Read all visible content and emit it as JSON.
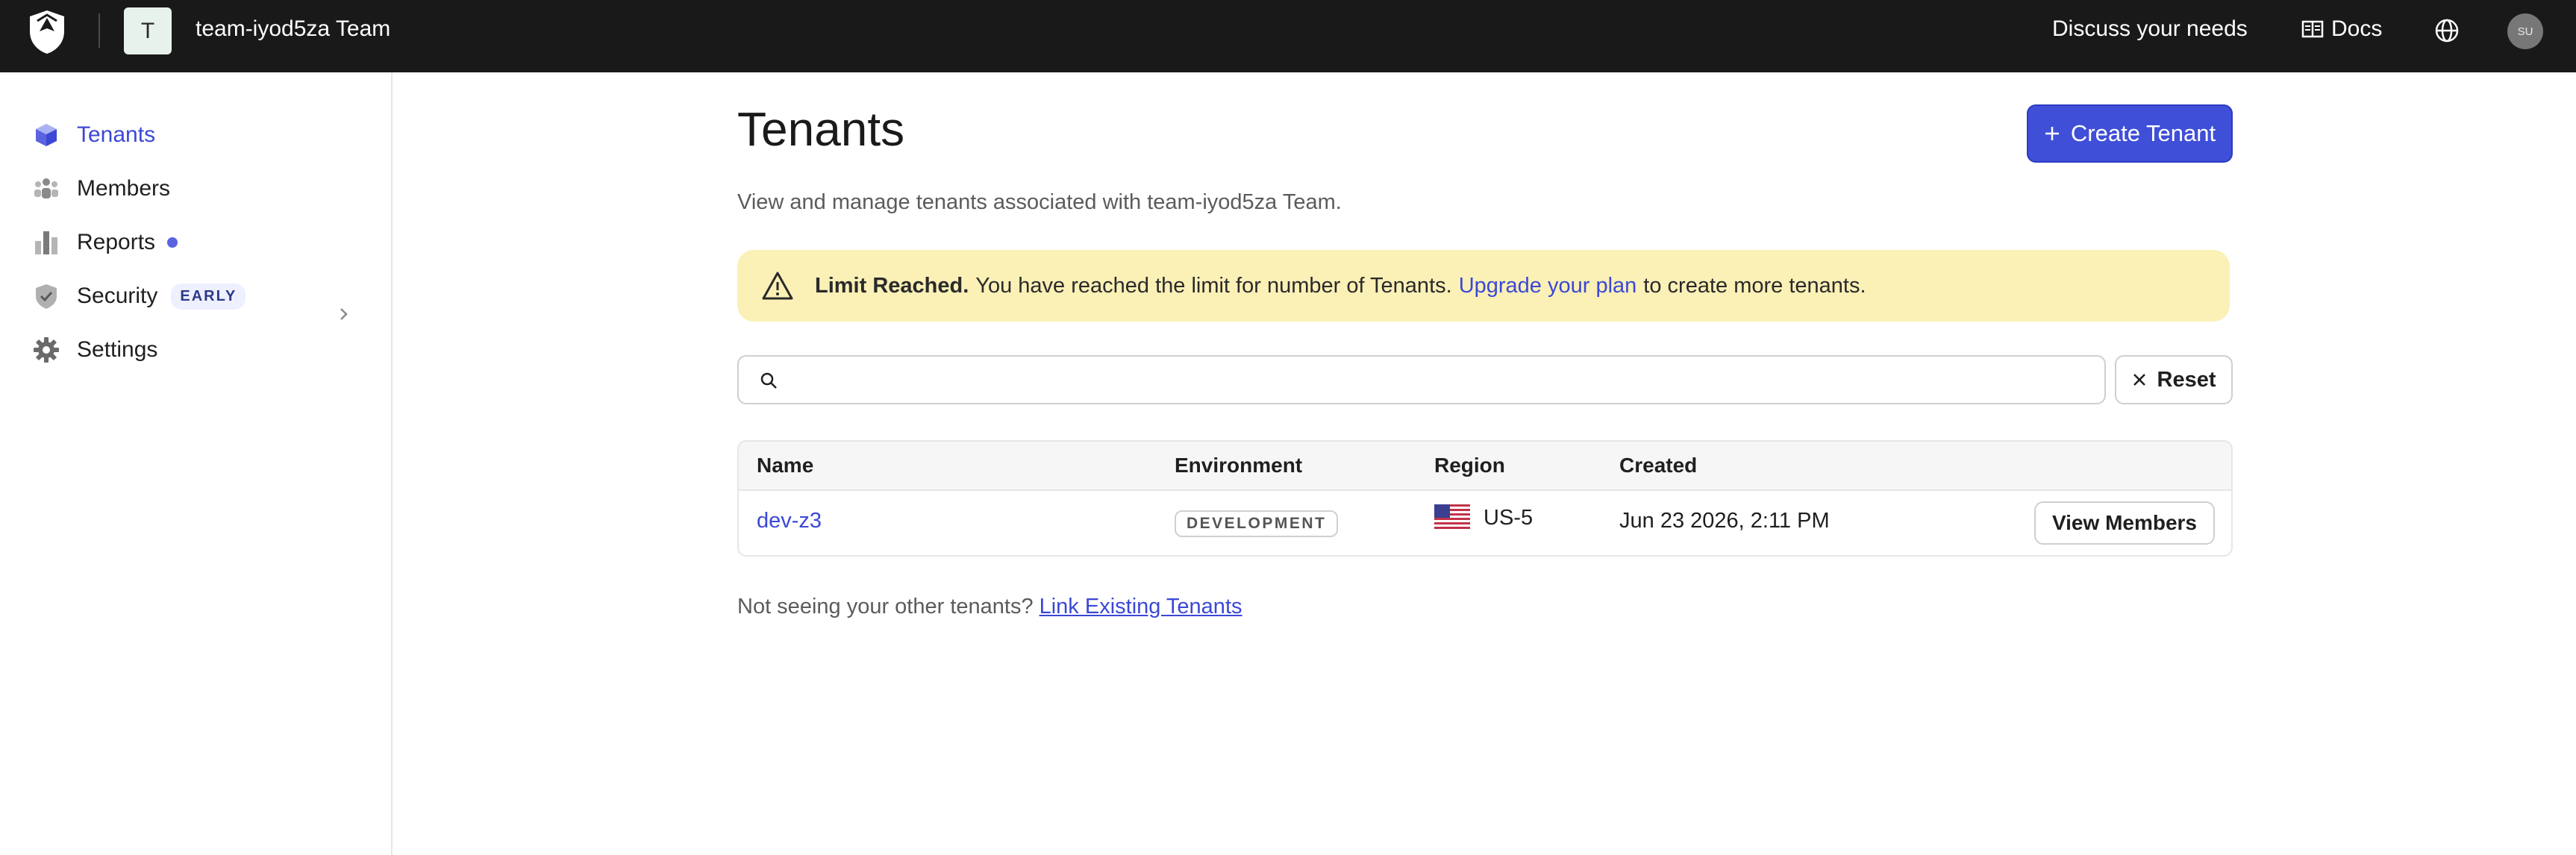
{
  "header": {
    "team_initial": "T",
    "team_name": "team-iyod5za Team",
    "discuss_label": "Discuss your needs",
    "docs_label": "Docs",
    "user_initials": "SU"
  },
  "sidebar": {
    "items": [
      {
        "label": "Tenants",
        "icon": "cube-icon",
        "active": true
      },
      {
        "label": "Members",
        "icon": "members-icon"
      },
      {
        "label": "Reports",
        "icon": "bar-chart-icon"
      },
      {
        "label": "Security",
        "icon": "shield-check-icon",
        "badge": "EARLY"
      },
      {
        "label": "Settings",
        "icon": "gear-icon"
      }
    ]
  },
  "main": {
    "title": "Tenants",
    "create_button": "Create Tenant",
    "subtitle": "View and manage tenants associated with team-iyod5za Team.",
    "alert": {
      "title": "Limit Reached.",
      "message": "You have reached the limit for number of Tenants.",
      "link_text": "Upgrade your plan",
      "suffix": "to create more tenants."
    },
    "search": {
      "value": "",
      "placeholder": ""
    },
    "reset_label": "Reset",
    "table": {
      "columns": [
        "Name",
        "Environment",
        "Region",
        "Created"
      ],
      "rows": [
        {
          "name": "dev-z3",
          "environment": "DEVELOPMENT",
          "region": "US-5",
          "created": "Jun 23 2026, 2:11 PM",
          "action": "View Members"
        }
      ]
    },
    "footnote": {
      "text": "Not seeing your other tenants?",
      "link": "Link Existing Tenants"
    }
  },
  "colors": {
    "accent": "#3f4fd8",
    "topbar": "#191919",
    "alert_bg": "#fbf0b6"
  }
}
